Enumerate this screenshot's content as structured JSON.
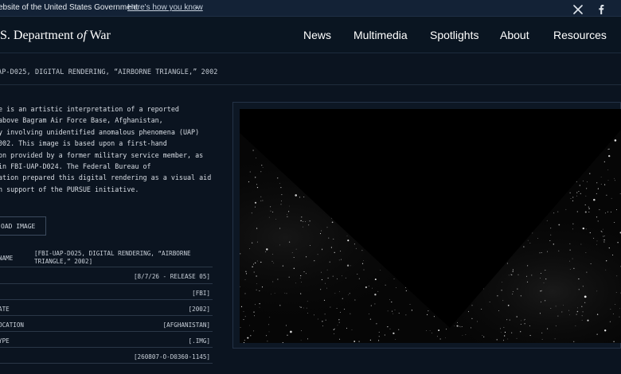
{
  "gov_banner": {
    "text": "ebsite of the United States Government",
    "link_label": "Here's how you know",
    "chevron": "⌄"
  },
  "header": {
    "logo_prefix": ".S. Department ",
    "logo_italic": "of",
    "logo_suffix": " War",
    "nav": [
      "News",
      "Multimedia",
      "Spotlights",
      "About",
      "Resources"
    ]
  },
  "page": {
    "title": "AP-D025, DIGITAL RENDERING, “AIRBORNE TRIANGLE,” 2002"
  },
  "description": {
    "lines": [
      "e is an artistic interpretation of a reported",
      "above Bagram Air Force Base, Afghanistan,",
      "y involving unidentified anomalous phenomena (UAP)",
      "002. This image is based upon a first-hand",
      "on provided by a former military service member, as",
      " in FBI-UAP-D024. The Federal Bureau of",
      "ation prepared this digital rendering as a visual aid",
      "n support of the PURSUE initiative."
    ]
  },
  "download": {
    "label": "OAD IMAGE"
  },
  "metadata": {
    "rows": [
      {
        "key": " NAME",
        "value": "[FBI-UAP-D025, DIGITAL RENDERING, “AIRBORNE TRIANGLE,” 2002]"
      },
      {
        "key": "",
        "value": "[8/7/26 - RELEASE 05]"
      },
      {
        "key": "",
        "value": "[FBI]"
      },
      {
        "key": "ATE",
        "value": "[2002]"
      },
      {
        "key": "OCATION",
        "value": "[AFGHANISTAN]"
      },
      {
        "key": "YPE",
        "value": "[.IMG]"
      },
      {
        "key": "",
        "value": "[260807-O-D0360-1145]"
      }
    ]
  },
  "image": {
    "subject": "dark triangle silhouette against a starfield",
    "sky_color": "#060606",
    "triangle_color": "#000000"
  },
  "icons": {
    "x": "x-logo-icon",
    "facebook": "facebook-icon"
  }
}
